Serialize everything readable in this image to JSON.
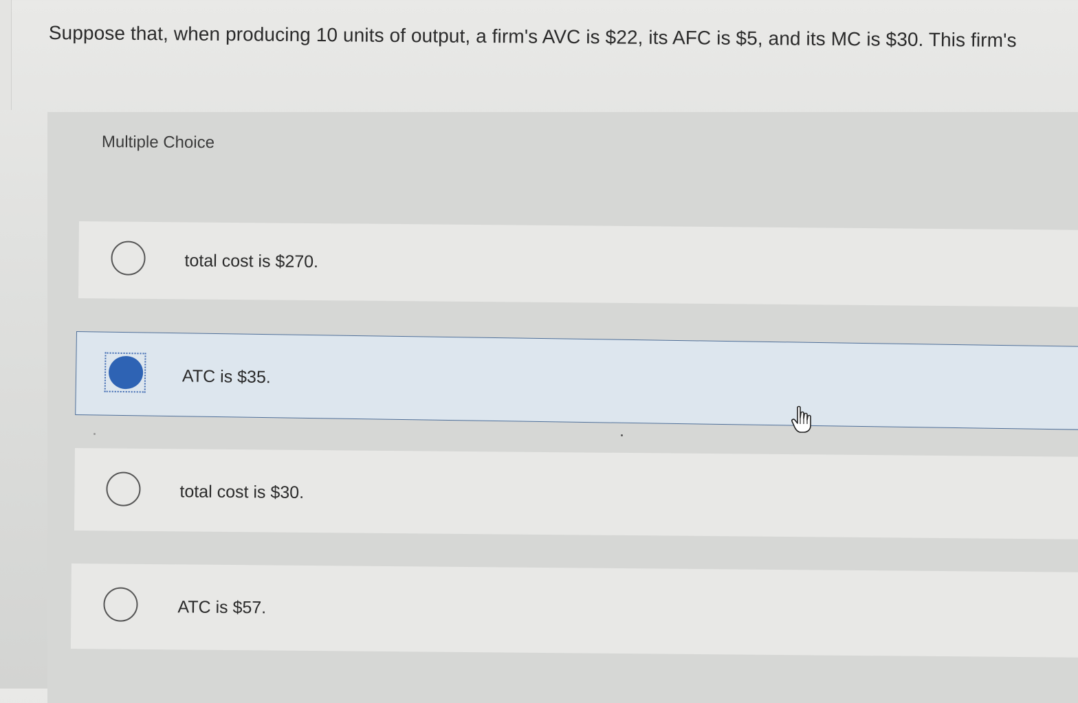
{
  "question": {
    "text": "Suppose that, when producing 10 units of output, a firm's AVC is $22, its AFC is $5, and its MC is $30. This firm's"
  },
  "multiple_choice": {
    "header": "Multiple Choice",
    "options": [
      {
        "label": "total cost is $270.",
        "selected": false
      },
      {
        "label": "ATC is $35.",
        "selected": true
      },
      {
        "label": "total cost is $30.",
        "selected": false
      },
      {
        "label": "ATC is $57.",
        "selected": false
      }
    ]
  },
  "colors": {
    "accent": "#2e63b4",
    "selected_background": "#dde6ee",
    "selected_border": "#4d6d97"
  },
  "icons": {
    "cursor": "hand-pointer-icon",
    "radio": "radio-button-icon"
  }
}
